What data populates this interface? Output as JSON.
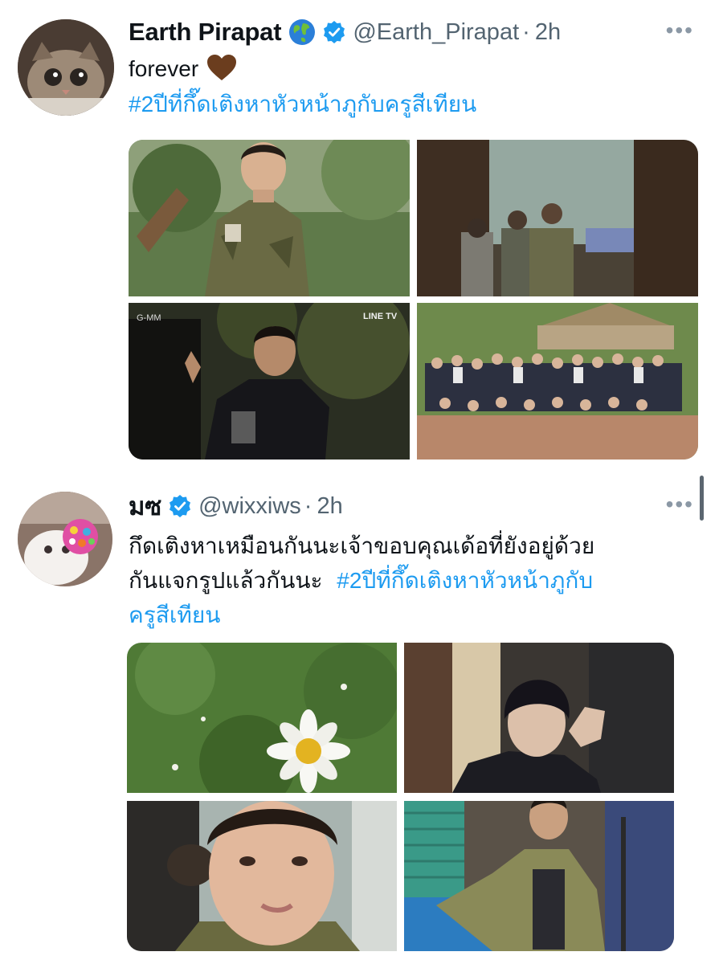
{
  "tweets": [
    {
      "display_name": "Earth Pirapat",
      "handle": "@Earth_Pirapat",
      "separator": "·",
      "time": "2h",
      "more": "•••",
      "text": "forever",
      "hashtag": "#2ปีที่กึ๊ดเติงหาหัวหน้าภูกับครูสีเทียน",
      "media_watermarks": [
        "G-MM",
        "LINE TV"
      ]
    },
    {
      "display_name": "มซ",
      "handle": "@wixxiws",
      "separator": "·",
      "time": "2h",
      "more": "•••",
      "text_line1": "กึดเติงหาเหมือนกันนะเจ้าขอบคุณเด้อที่ยังอยู่ด้วย",
      "text_line2": "กันแจกรูปแล้วกันนะ",
      "hashtag_part1": "#2ปีที่กึ๊ดเติงหาหัวหน้าภูกับ",
      "hashtag_part2": "ครูสีเทียน"
    }
  ],
  "colors": {
    "link": "#1d9bf0",
    "verified": "#1d9bf0",
    "secondary_text": "#536471",
    "heart": "#6b3d1e"
  },
  "icons": [
    "globe-emoji-icon",
    "verified-badge-icon",
    "more-options-icon",
    "brown-heart-emoji-icon"
  ]
}
